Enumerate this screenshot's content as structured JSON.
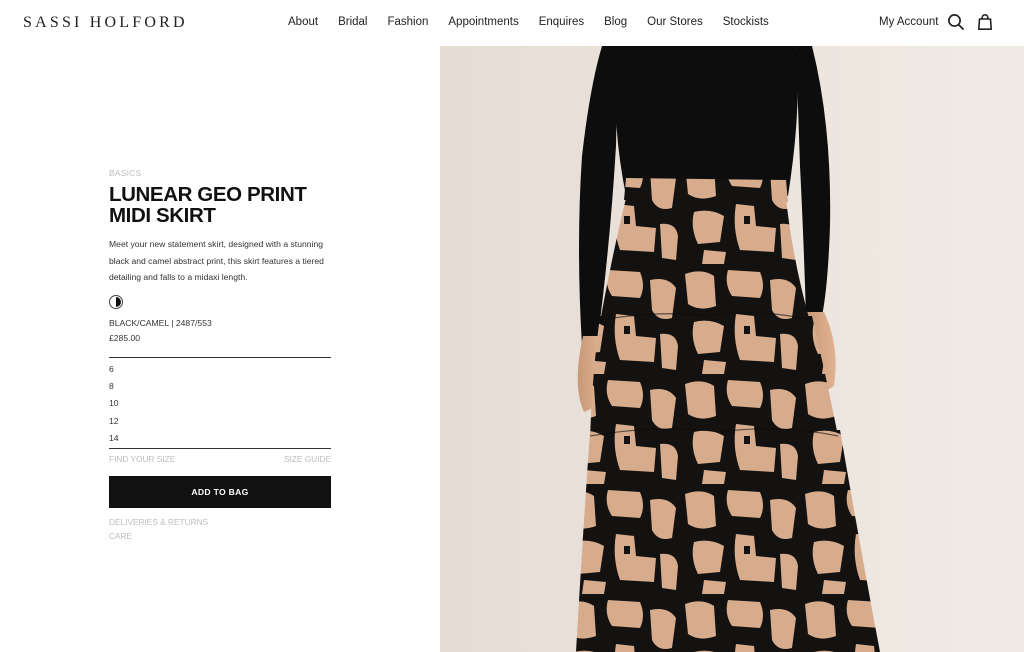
{
  "brand": {
    "logo_text": "SASSI HOLFORD"
  },
  "nav": {
    "items": [
      "About",
      "Bridal",
      "Fashion",
      "Appointments",
      "Enquires",
      "Blog",
      "Our Stores",
      "Stockists"
    ]
  },
  "header_actions": {
    "account_label": "My Account",
    "search_icon": "search-icon",
    "bag_icon": "shopping-bag-icon"
  },
  "product": {
    "category": "BASICS",
    "title": "LUNEAR GEO PRINT MIDI SKIRT",
    "description": "Meet your new statement skirt, designed with a stunning black and camel abstract print, this skirt features a tiered detailing and falls to a midaxi length.",
    "color_name": "BLACK/CAMEL",
    "sku": "2487/553",
    "price": "£285.00",
    "sizes": [
      "6",
      "8",
      "10",
      "12",
      "14"
    ],
    "find_size_label": "FIND YOUR SIZE",
    "size_guide_label": "SIZE GUIDE",
    "add_to_bag_label": "ADD TO BAG",
    "deliveries_label": "DELIVERIES & RETURNS",
    "care_label": "CARE"
  },
  "colors": {
    "accent": "#111111",
    "muted": "#bdbdbd",
    "camel": "#d7ac8c",
    "photo_bg": "#ebe3db"
  }
}
